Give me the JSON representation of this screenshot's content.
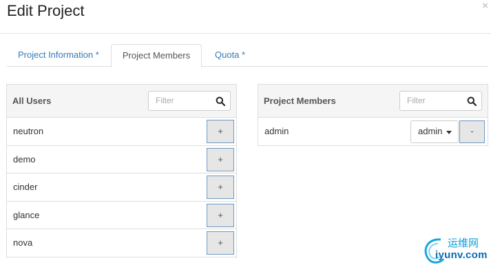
{
  "modal": {
    "title": "Edit Project",
    "close_glyph": "×"
  },
  "tabs": [
    {
      "label": "Project Information *"
    },
    {
      "label": "Project Members",
      "active": true
    },
    {
      "label": "Quota *"
    }
  ],
  "all_users": {
    "title": "All Users",
    "filter_placeholder": "Filter",
    "add_label": "+",
    "users": [
      {
        "name": "neutron"
      },
      {
        "name": "demo"
      },
      {
        "name": "cinder"
      },
      {
        "name": "glance"
      },
      {
        "name": "nova"
      }
    ]
  },
  "project_members": {
    "title": "Project Members",
    "filter_placeholder": "Filter",
    "members": [
      {
        "name": "admin",
        "role": "admin",
        "remove_label": "-"
      }
    ]
  },
  "watermark": {
    "line1": "运维网",
    "line2": "iyunv.com"
  },
  "icons": {
    "search": "search-icon",
    "caret": "caret-down-icon",
    "close": "close-icon"
  },
  "colors": {
    "link": "#337ab7",
    "button_border": "#6e98c2",
    "panel_header": "#f5f5f5"
  }
}
